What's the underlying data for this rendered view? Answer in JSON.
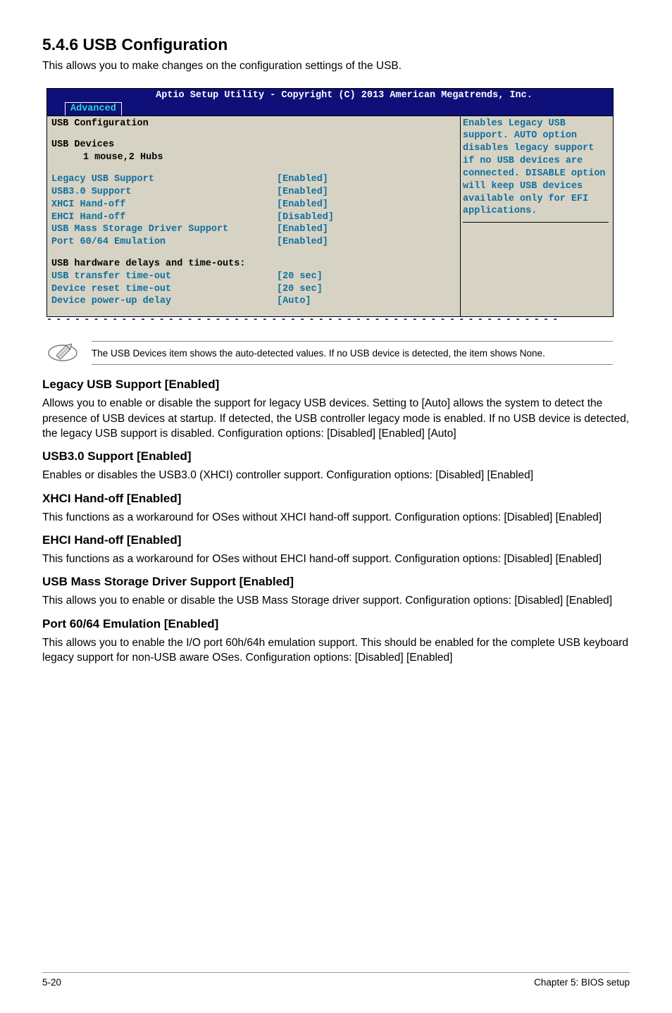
{
  "heading": "5.4.6 USB Configuration",
  "intro": "This allows you to make changes on the configuration settings of the USB.",
  "bios": {
    "header": "Aptio Setup Utility - Copyright (C) 2013 American Megatrends, Inc.",
    "tab": "Advanced",
    "title": "USB Configuration",
    "devices_label": "USB Devices",
    "devices_value": "1 mouse,2 Hubs",
    "rows": [
      {
        "label": "Legacy USB Support",
        "value": "[Enabled]"
      },
      {
        "label": "USB3.0 Support",
        "value": "[Enabled]"
      },
      {
        "label": "XHCI Hand-off",
        "value": "[Enabled]"
      },
      {
        "label": "EHCI Hand-off",
        "value": "[Disabled]"
      },
      {
        "label": "USB Mass Storage Driver Support",
        "value": "[Enabled]"
      },
      {
        "label": "Port 60/64 Emulation",
        "value": "[Enabled]"
      }
    ],
    "subheader": "USB hardware delays and time-outs:",
    "rows2": [
      {
        "label": "USB transfer time-out",
        "value": "[20 sec]"
      },
      {
        "label": "Device reset time-out",
        "value": "[20 sec]"
      },
      {
        "label": "Device power-up delay",
        "value": "[Auto]"
      }
    ],
    "help": "Enables Legacy USB support. AUTO option disables legacy support if no USB devices are connected. DISABLE option will keep USB devices available only for EFI applications."
  },
  "note": "The USB Devices item shows the auto-detected values. If no USB device is detected, the item shows None.",
  "sections": [
    {
      "title": "Legacy USB Support [Enabled]",
      "body": "Allows you to enable or disable the support for legacy USB devices. Setting to [Auto] allows the system to detect the presence of USB devices at startup. If detected, the USB controller legacy mode is enabled. If no USB device is detected, the legacy USB support is disabled. Configuration options: [Disabled] [Enabled] [Auto]"
    },
    {
      "title": "USB3.0 Support [Enabled]",
      "body": "Enables or disables the USB3.0 (XHCI) controller support. Configuration options: [Disabled] [Enabled]"
    },
    {
      "title": "XHCI Hand-off [Enabled]",
      "body": "This functions as a workaround for OSes without XHCI hand-off support. Configuration options: [Disabled] [Enabled]"
    },
    {
      "title": "EHCI Hand-off [Enabled]",
      "body": "This functions as a workaround for OSes without EHCI hand-off support. Configuration options: [Disabled] [Enabled]"
    },
    {
      "title": "USB Mass Storage Driver Support [Enabled]",
      "body": "This allows you to enable or disable the USB Mass Storage driver support. Configuration options: [Disabled] [Enabled]"
    },
    {
      "title": "Port 60/64 Emulation [Enabled]",
      "body": "This allows you to enable the I/O port 60h/64h emulation support. This should be enabled for the complete USB keyboard legacy support for non-USB aware OSes. Configuration options: [Disabled] [Enabled]"
    }
  ],
  "footer": {
    "left": "5-20",
    "right": "Chapter 5: BIOS setup"
  }
}
